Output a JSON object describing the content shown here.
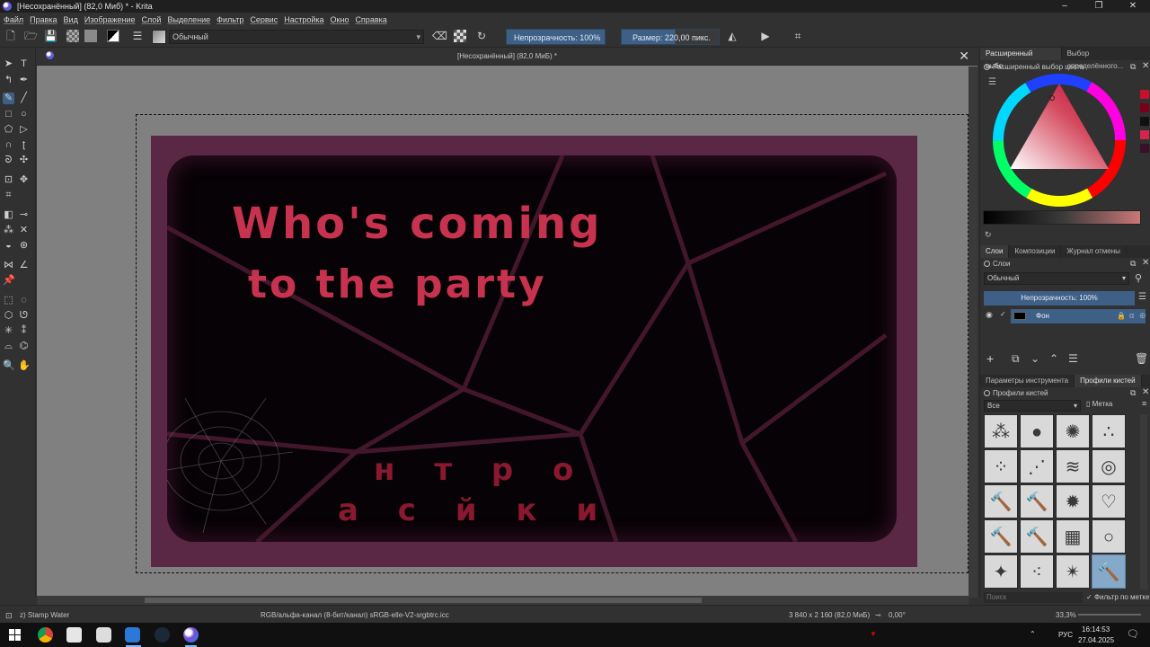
{
  "window": {
    "title": "[Несохранённый]  (82,0 Миб) * - Krita",
    "min_label": "–",
    "max_label": "❐",
    "close_label": "✕"
  },
  "menu": [
    "Файл",
    "Правка",
    "Вид",
    "Изображение",
    "Слой",
    "Выделение",
    "Фильтр",
    "Сервис",
    "Настройка",
    "Окно",
    "Справка"
  ],
  "toolbar": {
    "blend_mode": "Обычный",
    "opacity_label": "Непрозрачность: 100%",
    "size_label": "Размер: 220,00 пикс."
  },
  "document": {
    "tab_title": "[Несохранённый]  (82,0 МиБ) *",
    "painting_text_line1": "Who's coming",
    "painting_text_line2": "to the party",
    "painting_letters_bottom1": "н т р о",
    "painting_letters_bottom2": "а с й к и"
  },
  "dock": {
    "color_tabs": [
      "Расширенный выбо...",
      "Выбор определённого..."
    ],
    "color_panel_title": "Расширенный выбор цвета",
    "layer_tabs": [
      "Слои",
      "Композиции",
      "Журнал отмены"
    ],
    "layers_panel_title": "Слои",
    "layer_blend_mode": "Обычный",
    "layer_opacity": "Непрозрачность: 100%",
    "layers": [
      {
        "name": "Фон"
      }
    ],
    "brush_tabs": [
      "Параметры инструмента",
      "Профили кистей"
    ],
    "brush_panel_title": "Профили кистей",
    "brush_filter": "Все",
    "brush_tag_label": "Метка",
    "search_placeholder": "Поиск",
    "filter_by_tag": "Фильтр по метке"
  },
  "status": {
    "brush_name": "z) Stamp Water",
    "color_space": "RGB/альфа-канал (8-бит/канал)  sRGB-elle-V2-srgbtrc.icc",
    "image_size": "3 840 x 2 160 (82,0 МиБ)",
    "rotation": "0,00°",
    "zoom": "33,3%"
  },
  "taskbar": {
    "language": "РУС",
    "time": "16:14:53",
    "date": "27.04.2025"
  }
}
